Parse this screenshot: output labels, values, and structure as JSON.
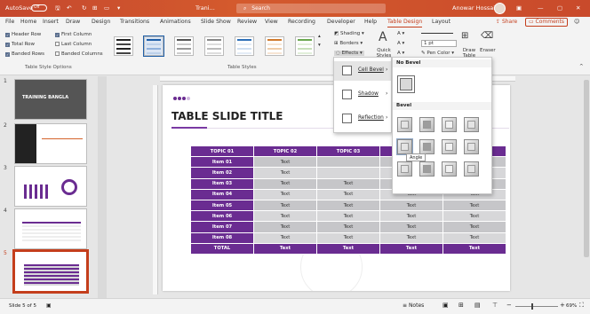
{
  "titlebar": {
    "autosave_label": "AutoSave",
    "autosave_state": "Off",
    "file_name": "Trani...",
    "search_placeholder": "Search",
    "user_name": "Anowar Hossain"
  },
  "tabs": [
    "File",
    "Home",
    "Insert",
    "Draw",
    "Design",
    "Transitions",
    "Animations",
    "Slide Show",
    "Review",
    "View",
    "Recording",
    "Developer",
    "Help",
    "Table Design",
    "Layout"
  ],
  "active_tab": "Table Design",
  "share_label": "Share",
  "comments_label": "Comments",
  "ribbon": {
    "style_options": [
      {
        "label": "Header Row",
        "checked": true
      },
      {
        "label": "First Column",
        "checked": true
      },
      {
        "label": "Total Row",
        "checked": true
      },
      {
        "label": "Last Column",
        "checked": false
      },
      {
        "label": "Banded Rows",
        "checked": true
      },
      {
        "label": "Banded Columns",
        "checked": false
      }
    ],
    "style_options_group": "Table Style Options",
    "table_styles_group": "Table Styles",
    "shading_label": "Shading",
    "borders_label": "Borders",
    "effects_label": "Effects",
    "quick_styles_label": "Quick Styles",
    "pen_weight": "1 pt",
    "pen_color_label": "Pen Color",
    "draw_table_label": "Draw Table",
    "eraser_label": "Eraser"
  },
  "effects_menu": {
    "items": [
      {
        "label": "Cell Bevel"
      },
      {
        "label": "Shadow"
      },
      {
        "label": "Reflection"
      }
    ]
  },
  "bevel_gallery": {
    "no_bevel_heading": "No Bevel",
    "bevel_heading": "Bevel",
    "tooltip": "Angle"
  },
  "slide": {
    "title": "TABLE SLIDE TITLE",
    "table": {
      "headers": [
        "TOPIC 01",
        "TOPIC 02",
        "TOPIC 03",
        "",
        ""
      ],
      "rows": [
        [
          "Item 01",
          "Text",
          "",
          "",
          ""
        ],
        [
          "Item 02",
          "Text",
          "",
          "",
          ""
        ],
        [
          "Item 03",
          "Text",
          "Text",
          "Text",
          "Text"
        ],
        [
          "Item 04",
          "Text",
          "Text",
          "Text",
          "Text"
        ],
        [
          "Item 05",
          "Text",
          "Text",
          "Text",
          "Text"
        ],
        [
          "Item 06",
          "Text",
          "Text",
          "Text",
          "Text"
        ],
        [
          "Item 07",
          "Text",
          "Text",
          "Text",
          "Text"
        ],
        [
          "Item 08",
          "Text",
          "Text",
          "Text",
          "Text"
        ]
      ],
      "total": [
        "TOTAL",
        "Text",
        "Text",
        "Text",
        "Text"
      ]
    }
  },
  "thumbnails": {
    "numbers": [
      "1",
      "2",
      "3",
      "4",
      "5"
    ],
    "thumb1_title": "TRAINING BANGLA",
    "selected": "5"
  },
  "statusbar": {
    "slide_info": "Slide 5 of 5",
    "notes_label": "Notes",
    "zoom": "69%"
  },
  "colors": {
    "accent": "#c43e1c",
    "table_purple": "#6a2c91"
  }
}
